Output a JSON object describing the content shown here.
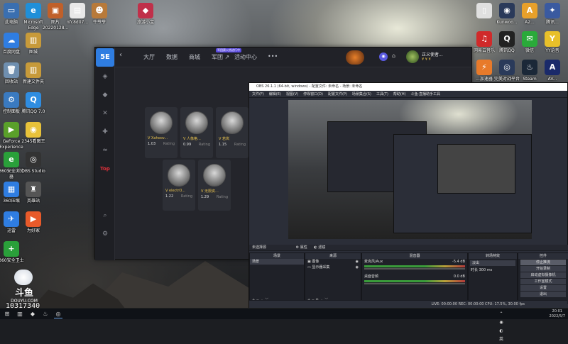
{
  "desktop_icons_left": [
    {
      "label": "此电脑",
      "icon": "computer-icon",
      "color": "#3a6fb0",
      "glyph": "▭"
    },
    {
      "label": "Microsoft Edge",
      "icon": "edge-icon",
      "color": "#1f8fd8",
      "glyph": "e"
    },
    {
      "label": "图片 20220128...",
      "icon": "image-icon",
      "color": "#c0602a",
      "glyph": "▣"
    },
    {
      "label": "nfc8d07...",
      "icon": "file-icon",
      "color": "#e8e8e8",
      "glyph": "▤"
    },
    {
      "label": "牛爷爷",
      "icon": "avatar-icon",
      "color": "#b87a3a",
      "glyph": "☻"
    },
    {
      "label": "旅游小宝",
      "icon": "game-icon",
      "color": "#c0304a",
      "glyph": "◆"
    },
    {
      "label": "百度网盘",
      "icon": "cloud-icon",
      "color": "#2f7de1",
      "glyph": "☁"
    },
    {
      "label": "图城",
      "icon": "doc-icon",
      "color": "#c79a3a",
      "glyph": "▥"
    },
    {
      "label": "回收站",
      "icon": "recycle-bin-icon",
      "color": "#6f8fb0",
      "glyph": "🗑"
    },
    {
      "label": "新建文件夹",
      "icon": "folder-icon",
      "color": "#c79a3a",
      "glyph": "▥"
    },
    {
      "label": "控制面板",
      "icon": "control-panel-icon",
      "color": "#3a7ac0",
      "glyph": "⚙"
    },
    {
      "label": "腾讯QQ 7.0",
      "icon": "qq-icon",
      "color": "#2f8de1",
      "glyph": "Q"
    },
    {
      "label": "GeForce Experience",
      "icon": "nvidia-icon",
      "color": "#5aa02a",
      "glyph": "▶"
    },
    {
      "label": "2345看图王",
      "icon": "photo-viewer-icon",
      "color": "#e8c23a",
      "glyph": "◉"
    },
    {
      "label": "360安全浏览器",
      "icon": "browser-360-icon",
      "color": "#2aa03a",
      "glyph": "e"
    },
    {
      "label": "OBS Studio",
      "icon": "obs-icon",
      "color": "#333",
      "glyph": "◎"
    },
    {
      "label": "360压缩",
      "icon": "zip-icon",
      "color": "#2f7de1",
      "glyph": "▦"
    },
    {
      "label": "英雄站",
      "icon": "hero-icon",
      "color": "#555",
      "glyph": "♜"
    },
    {
      "label": "迅雷",
      "icon": "thunder-icon",
      "color": "#2f7de1",
      "glyph": "✈"
    },
    {
      "label": "为好家",
      "icon": "app-icon",
      "color": "#e85a2a",
      "glyph": "▶"
    },
    {
      "label": "360安全卫士",
      "icon": "shield-360-icon",
      "color": "#2aa03a",
      "glyph": "+"
    }
  ],
  "desktop_icons_right": [
    {
      "label": "",
      "icon": "blank-file-icon",
      "color": "#e0e0e0",
      "glyph": "▯"
    },
    {
      "label": "Kunwoo...",
      "icon": "ring-icon",
      "color": "#2a3a5a",
      "glyph": "◉"
    },
    {
      "label": "A2...",
      "icon": "a-icon",
      "color": "#e8a02a",
      "glyph": "A"
    },
    {
      "label": "腾讯...",
      "icon": "tencent-icon",
      "color": "#3a5aa0",
      "glyph": "✦"
    },
    {
      "label": "网易云音乐",
      "icon": "netease-music-icon",
      "color": "#d02a2a",
      "glyph": "♫"
    },
    {
      "label": "腾讯QQ",
      "icon": "qq2-icon",
      "color": "#222",
      "glyph": "Q"
    },
    {
      "label": "微信",
      "icon": "wechat-icon",
      "color": "#2aaa3a",
      "glyph": "✉"
    },
    {
      "label": "YY语音",
      "icon": "yy-icon",
      "color": "#e8c02a",
      "glyph": "Y"
    },
    {
      "label": "...加速器",
      "icon": "booster-icon",
      "color": "#e87a2a",
      "glyph": "⚡"
    },
    {
      "label": "完美对战平台",
      "icon": "perfect-icon",
      "color": "#2a3a5a",
      "glyph": "◎"
    },
    {
      "label": "Steam",
      "icon": "steam-icon",
      "color": "#1b2838",
      "glyph": "♨"
    },
    {
      "label": "AV...",
      "icon": "av-icon",
      "color": "#1a2a6a",
      "glyph": "A"
    }
  ],
  "app5e": {
    "nav": [
      "大厅",
      "数据",
      "商城",
      "军团 ↗",
      "活动中心",
      "•••"
    ],
    "badge": "军团赛火热进行中",
    "user": {
      "name": "正义使者...",
      "sub": "¥ ¥ ¥"
    },
    "side_mark": "Top",
    "players": [
      {
        "name": "V Xahoov...",
        "score": "1.03",
        "rating": "Rating",
        "icon": "player-avatar-1"
      },
      {
        "name": "V 人像格...",
        "score": "0.99",
        "rating": "Rating",
        "icon": "player-avatar-2"
      },
      {
        "name": "V 若岚",
        "score": "1.15",
        "rating": "Rating",
        "icon": "player-avatar-3"
      },
      {
        "name": "V electrO...",
        "score": "1.22",
        "rating": "Rating",
        "icon": "player-avatar-4"
      },
      {
        "name": "V 无限资...",
        "score": "1.29",
        "rating": "Rating",
        "icon": "player-avatar-5"
      }
    ]
  },
  "obs": {
    "title": "OBS 26.1.1 (64-bit, windows) - 配置文件: 未命名 - 场景: 未命名",
    "menu": [
      "文件(F)",
      "编辑(E)",
      "视图(V)",
      "停靠窗口(D)",
      "配置文件(P)",
      "场景集合(S)",
      "工具(T)",
      "帮助(H)",
      "斗鱼·直播助手工具"
    ],
    "no_source": "未选择源",
    "attr_btn": "属性",
    "filter_btn": "滤镜",
    "panels": {
      "scenes": "场景",
      "sources": "来源",
      "mixer": "混音器",
      "transitions": "转场特效",
      "controls": "控件"
    },
    "scene_items": [
      "场景"
    ],
    "source_items": [
      "图像",
      "显示器采集"
    ],
    "mixer": [
      {
        "name": "麦克风/Aux",
        "db": "-5.4 dB"
      },
      {
        "name": "桌面音频",
        "db": "0.0 dB"
      }
    ],
    "transition": {
      "name": "淡出",
      "duration_label": "时长",
      "duration": "300 ms"
    },
    "controls": [
      "停止推流",
      "开始录制",
      "启动虚拟摄像机",
      "工作室模式",
      "设置",
      "退出"
    ],
    "status": "LIVE: 00:00:00   REC: 00:00:00   CPU: 17.5%, 30.00 fps"
  },
  "douyu": {
    "brand": "斗鱼",
    "site": "DOUYU.COM",
    "room": "10317340"
  },
  "taskbar": {
    "time": "20:01",
    "date": "2022/5/7"
  }
}
